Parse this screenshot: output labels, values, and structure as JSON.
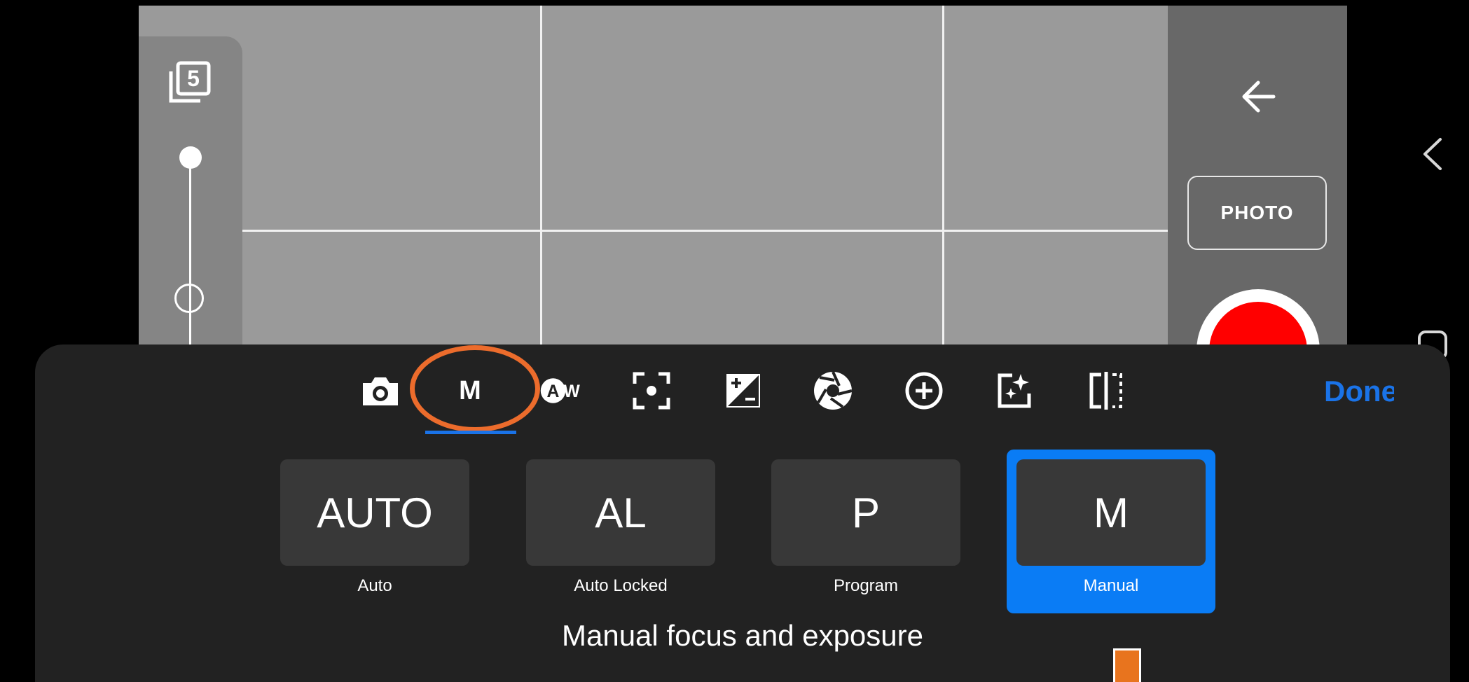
{
  "camera": {
    "photo_label": "PHOTO"
  },
  "burst": {
    "count": "5"
  },
  "toolbar": {
    "tools": [
      "camera-icon",
      "manual-mode-icon",
      "auto-white-balance-icon",
      "focus-icon",
      "exposure-compensation-icon",
      "aperture-icon",
      "add-icon",
      "enhance-icon",
      "split-view-icon"
    ],
    "manual_label": "M",
    "done_label": "Done"
  },
  "modes": [
    {
      "short": "AUTO",
      "label": "Auto"
    },
    {
      "short": "AL",
      "label": "Auto Locked"
    },
    {
      "short": "P",
      "label": "Program"
    },
    {
      "short": "M",
      "label": "Manual"
    }
  ],
  "selected_mode": "M",
  "mode_description": "Manual focus and exposure",
  "colors": {
    "accent": "#1a73e8",
    "highlight": "#ec6c2c",
    "shutter": "#ff0000"
  }
}
